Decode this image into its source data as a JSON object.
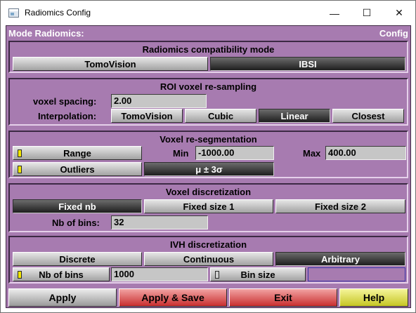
{
  "window": {
    "title": "Radiomics Config",
    "minimize_glyph": "—",
    "maximize_glyph": "☐",
    "close_glyph": "✕"
  },
  "header": {
    "left": "Mode Radiomics:",
    "right": "Config"
  },
  "compat": {
    "title": "Radiomics compatibility mode",
    "opt1": "TomoVision",
    "opt2": "IBSI",
    "selected": "IBSI"
  },
  "roi": {
    "title": "ROI voxel re-sampling",
    "spacing_label": "voxel spacing:",
    "spacing_value": "2.00",
    "interp_label": "Interpolation:",
    "interp1": "TomoVision",
    "interp2": "Cubic",
    "interp3": "Linear",
    "interp4": "Closest",
    "selected": "Linear"
  },
  "reseg": {
    "title": "Voxel re-segmentation",
    "range_label": "Range",
    "range_led": "yellow",
    "min_label": "Min",
    "min_value": "-1000.00",
    "max_label": "Max",
    "max_value": "400.00",
    "outliers_label": "Outliers",
    "outliers_led": "yellow",
    "sigma_label": "μ ± 3σ"
  },
  "disc": {
    "title": "Voxel discretization",
    "opt1": "Fixed nb",
    "opt2": "Fixed size 1",
    "opt3": "Fixed size 2",
    "selected": "Fixed nb",
    "nbins_label": "Nb of bins:",
    "nbins_value": "32"
  },
  "ivh": {
    "title": "IVH discretization",
    "opt1": "Discrete",
    "opt2": "Continuous",
    "opt3": "Arbitrary",
    "selected": "Arbitrary",
    "nbins_label": "Nb of bins",
    "nbins_led": "yellow",
    "nbins_value": "1000",
    "binsize_label": "Bin size",
    "binsize_led": "grey",
    "binsize_value": ""
  },
  "footer": {
    "apply": "Apply",
    "apply_save": "Apply & Save",
    "exit": "Exit",
    "help": "Help"
  },
  "colors": {
    "panel": "#a77bb0",
    "header_text": "#ffffff",
    "led_on": "#f2e600",
    "apply_save": "#c92f2f",
    "help": "#c6c624"
  }
}
